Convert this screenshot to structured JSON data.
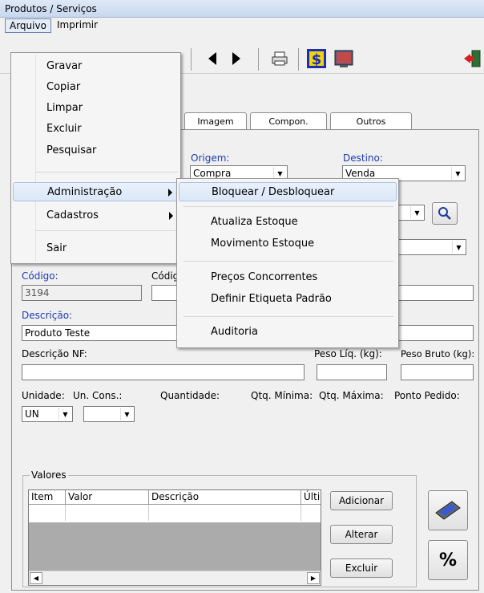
{
  "window": {
    "title": "Produtos / Serviços"
  },
  "menubar": {
    "arquivo": "Arquivo",
    "imprimir": "Imprimir"
  },
  "arquivo_menu": {
    "gravar": "Gravar",
    "copiar": "Copiar",
    "limpar": "Limpar",
    "excluir": "Excluir",
    "pesquisar": "Pesquisar",
    "administracao": "Administração",
    "cadastros": "Cadastros",
    "sair": "Sair"
  },
  "admin_submenu": {
    "bloquear": "Bloquear / Desbloquear",
    "atualiza": "Atualiza Estoque",
    "movimento": "Movimento Estoque",
    "precos": "Preços Concorrentes",
    "etiqueta": "Definir Etiqueta Padrão",
    "auditoria": "Auditoria"
  },
  "tabs": {
    "imagem": "Imagem",
    "compon": "Compon.",
    "outros": "Outros"
  },
  "form": {
    "origem_label": "Origem:",
    "origem_value": "Compra",
    "destino_label": "Destino:",
    "destino_value": "Venda",
    "codigo_label": "Código:",
    "codigo_value": "3194",
    "codigo2_label": "Códig",
    "descricao_label": "Descrição:",
    "descricao_value": "Produto Teste",
    "descricao_nf_label": "Descrição NF:",
    "peso_liq_label": "Peso Líq. (kg):",
    "peso_bruto_label": "Peso Bruto (kg):",
    "unidade_label": "Unidade:",
    "unidade_value": "UN",
    "un_cons_label": "Un. Cons.:",
    "quantidade_label": "Quantidade:",
    "qtd_min_label": "Qtq. Mínima:",
    "qtd_max_label": "Qtq. Máxima:",
    "ponto_pedido_label": "Ponto Pedido:"
  },
  "valores": {
    "legend": "Valores",
    "columns": [
      "Item",
      "Valor",
      "Descrição",
      "Últi"
    ],
    "buttons": {
      "adicionar": "Adicionar",
      "alterar": "Alterar",
      "excluir": "Excluir"
    },
    "percent": "%"
  },
  "colors": {
    "label_blue": "#1c3bb5",
    "title_bg": "#c7d8ee"
  }
}
